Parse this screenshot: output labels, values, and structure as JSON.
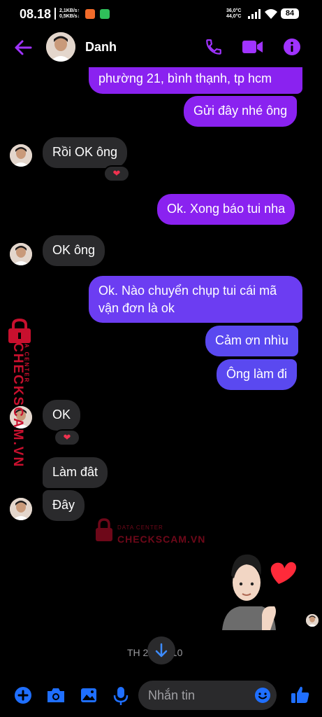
{
  "status_bar": {
    "time": "08.18",
    "net_up": "2,1KB/s↑",
    "net_down": "0,5KB/s↓",
    "temp_1": "36,0°C",
    "temp_2": "44,0°C",
    "battery": "84"
  },
  "header": {
    "contact_name": "Danh",
    "icons": [
      "back-arrow",
      "phone",
      "video-camera",
      "info"
    ]
  },
  "messages": [
    {
      "side": "out",
      "text": "phường 21, bình thạnh, tp hcm"
    },
    {
      "side": "out",
      "text": "Gửi đây nhé ông"
    },
    {
      "side": "in",
      "text": "Rồi OK ông",
      "reaction": "❤"
    },
    {
      "side": "out",
      "text": "Ok. Xong báo tui nha"
    },
    {
      "side": "in",
      "text": "OK ông"
    },
    {
      "side": "out",
      "text": "Ok. Nào chuyển chụp tui cái mã vận đơn là ok",
      "line1": "Ok. Nào chuyển chụp tui cái mã",
      "line2": "vận đơn là ok"
    },
    {
      "side": "out",
      "text": "Cảm ơn nhìu"
    },
    {
      "side": "out",
      "text": "Ông làm đi"
    },
    {
      "side": "in",
      "text": "OK",
      "reaction": "❤"
    },
    {
      "side": "in",
      "text": "Làm đât"
    },
    {
      "side": "in",
      "text": "Đây"
    }
  ],
  "watermark": {
    "big": "CHECKSCAM.VN",
    "small": "DATA CENTER"
  },
  "timestamp": "TH 2 … 6:10",
  "composer": {
    "placeholder": "Nhắn tin",
    "icons": [
      "plus",
      "camera",
      "image",
      "microphone",
      "emoji",
      "thumbs-up"
    ]
  },
  "colors": {
    "accent": "#8a2be2",
    "bubble_in": "#2a2a2c",
    "bubble_out_top": "#8a22f0",
    "bubble_out_bottom": "#5a49f0",
    "reaction_heart": "#f0324f",
    "watermark": "#c8102e"
  }
}
